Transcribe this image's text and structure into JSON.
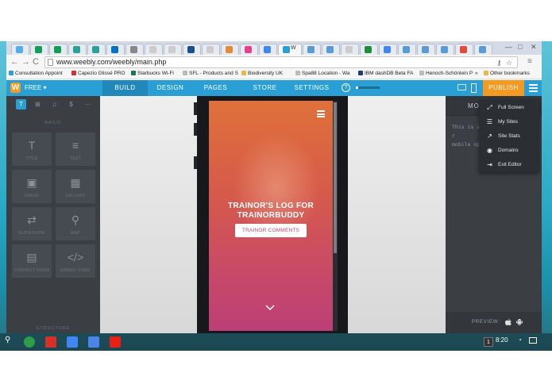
{
  "browser": {
    "tabs": [
      {
        "name": "twitter",
        "color": "#55acee"
      },
      {
        "name": "sheets",
        "color": "#0f9d58"
      },
      {
        "name": "sheets2",
        "color": "#0f9d58"
      },
      {
        "name": "tab4",
        "color": "#2aa198"
      },
      {
        "name": "tab5",
        "color": "#2aa198"
      },
      {
        "name": "outlook",
        "color": "#0072c6"
      },
      {
        "name": "doc",
        "color": "#888888"
      },
      {
        "name": "page",
        "color": "#cccccc"
      },
      {
        "name": "page2",
        "color": "#cccccc"
      },
      {
        "name": "tp",
        "color": "#1b4f8a"
      },
      {
        "name": "page3",
        "color": "#cccccc"
      },
      {
        "name": "gallery",
        "color": "#e58a3a"
      },
      {
        "name": "pink",
        "color": "#e83e8c"
      },
      {
        "name": "google",
        "color": "#4285f4"
      },
      {
        "name": "weebly",
        "color": "#2a9fd6"
      },
      {
        "name": "w2",
        "color": "#5b9bd5"
      },
      {
        "name": "w3",
        "color": "#5b9bd5"
      },
      {
        "name": "page4",
        "color": "#cccccc"
      },
      {
        "name": "chrome",
        "color": "#1e8e3e"
      },
      {
        "name": "google2",
        "color": "#4285f4"
      },
      {
        "name": "tab21",
        "color": "#5b9bd5"
      },
      {
        "name": "tab22",
        "color": "#5b9bd5"
      },
      {
        "name": "tab23",
        "color": "#5b9bd5"
      },
      {
        "name": "tab24",
        "color": "#e04a3a"
      },
      {
        "name": "tab25",
        "color": "#5b9bd5"
      }
    ],
    "active_tab_label": "W",
    "window_controls": {
      "minimize": "—",
      "maximize": "□",
      "close": "✕"
    },
    "nav": {
      "back": "←",
      "forward": "→",
      "reload": "C"
    },
    "url": "www.weebly.com/weebly/main.php",
    "omnibox_icons": {
      "key": "⚷",
      "star": "☆",
      "menu": "≡"
    },
    "bookmarks": [
      {
        "label": "Consultation Appoint",
        "color": "#2a9fd6"
      },
      {
        "label": "Capezio Glissé PRO",
        "color": "#cc3333"
      },
      {
        "label": "Starbucks Wi-Fi",
        "color": "#1e7a44"
      },
      {
        "label": "SFL - Products and S",
        "color": "#bbbbbb"
      },
      {
        "label": "Biodiversity UK",
        "color": "#e8b84a"
      },
      {
        "label": "Spa88 Location - Wa",
        "color": "#bbbbbb"
      },
      {
        "label": "IBM dashDB Beta FA",
        "color": "#1f3d7a"
      },
      {
        "label": "Henoch-Schönlein P",
        "color": "#bbbbbb"
      }
    ],
    "bookmarks_overflow": "»",
    "other_bookmarks": "Other bookmarks"
  },
  "weebly": {
    "logo": "W",
    "plan": "FREE ▾",
    "nav": [
      {
        "label": "BUILD",
        "active": true
      },
      {
        "label": "DESIGN",
        "active": false
      },
      {
        "label": "PAGES",
        "active": false
      },
      {
        "label": "STORE",
        "active": false
      },
      {
        "label": "SETTINGS",
        "active": false
      }
    ],
    "help": "?",
    "progress": 0.1,
    "publish": "PUBLISH"
  },
  "sidebar": {
    "tabs": [
      "T",
      "⊞",
      "♫",
      "$",
      "···"
    ],
    "section_basic": "BASIC",
    "elements": [
      {
        "icon": "T",
        "label": "TITLE"
      },
      {
        "icon": "≡",
        "label": "TEXT"
      },
      {
        "icon": "▣",
        "label": "IMAGE"
      },
      {
        "icon": "▦",
        "label": "GALLERY"
      },
      {
        "icon": "⇄",
        "label": "SLIDESHOW"
      },
      {
        "icon": "⚲",
        "label": "MAP"
      },
      {
        "icon": "▤",
        "label": "CONTACT FORM"
      },
      {
        "icon": "</>",
        "label": "EMBED CODE"
      }
    ],
    "section_structure": "STRUCTURE"
  },
  "phone": {
    "title_line1": "TRAINOR'S LOG FOR",
    "title_line2": "TRAINORBUDDY",
    "cta": "TRAINOR COMMENTS",
    "scroll_icon": "⌄"
  },
  "right_panel": {
    "title": "MO",
    "body_line1": "This is a r",
    "body_line2": "mobile op",
    "preview_label": "PREVIEW:",
    "apple": "",
    "android": "◆"
  },
  "menu": {
    "items": [
      {
        "icon": "⤢",
        "label": "Full Screen"
      },
      {
        "icon": "☰",
        "label": "My Sites"
      },
      {
        "icon": "↗",
        "label": "Site Stats"
      },
      {
        "icon": "◉",
        "label": "Domains"
      },
      {
        "icon": "⇥",
        "label": "Exit Editor"
      }
    ]
  },
  "taskbar": {
    "search": "⚲",
    "apps": [
      {
        "name": "chrome",
        "color": "#2e9d47"
      },
      {
        "name": "gmail",
        "color": "#d93025"
      },
      {
        "name": "google-plus",
        "color": "#4285f4"
      },
      {
        "name": "docs",
        "color": "#4a86e8"
      },
      {
        "name": "youtube",
        "color": "#e62117"
      }
    ],
    "workspace": "1",
    "time": "8:20"
  }
}
